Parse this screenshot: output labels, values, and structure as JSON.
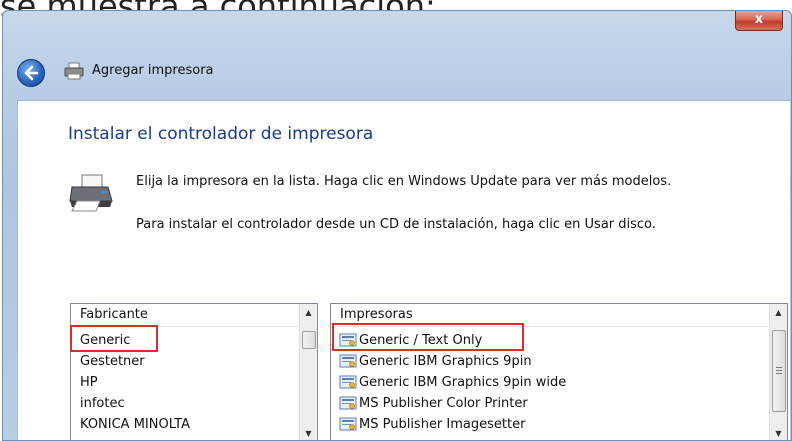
{
  "doc_heading": "se muestra a continuación:",
  "window": {
    "close_glyph": "x",
    "nav_title": "Agregar impresora",
    "section_title": "Instalar el controlador de impresora",
    "instruction_1": "Elija la impresora en la lista. Haga clic en Windows Update para ver más modelos.",
    "instruction_2": "Para instalar el controlador desde un CD de instalación, haga clic en Usar disco."
  },
  "manufacturers": {
    "header": "Fabricante",
    "items": [
      "Generic",
      "Gestetner",
      "HP",
      "infotec",
      "KONICA MINOLTA"
    ],
    "selected": "Generic"
  },
  "printers": {
    "header": "Impresoras",
    "items": [
      "Generic / Text Only",
      "Generic IBM Graphics 9pin",
      "Generic IBM Graphics 9pin wide",
      "MS Publisher Color Printer",
      "MS Publisher Imagesetter"
    ],
    "selected": "Generic / Text Only"
  },
  "icons": {
    "back": "back-arrow-icon",
    "printer": "printer-icon",
    "driver": "printer-driver-icon"
  },
  "colors": {
    "title_blue": "#1e3a8a",
    "highlight_red": "#e02b2b",
    "close_red": "#c43a26"
  }
}
